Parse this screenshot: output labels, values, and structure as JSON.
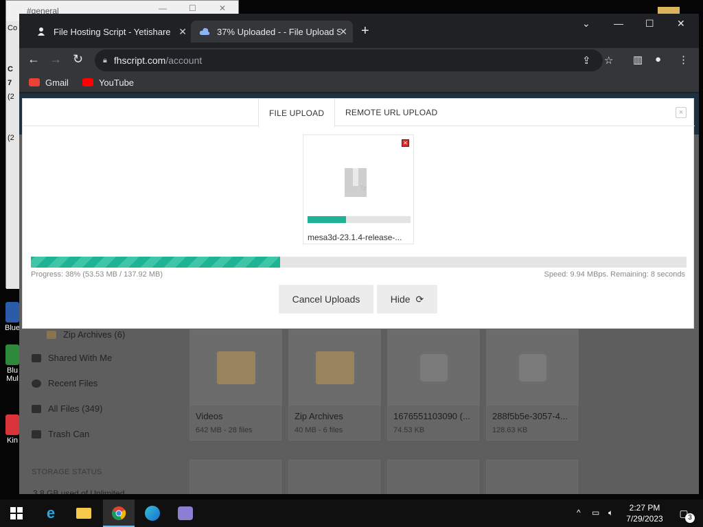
{
  "desktop": {
    "bg_window_title": "#general",
    "bg_window_menu": "Co",
    "bg_side_labels": [
      "C",
      "7",
      "(2",
      "(2"
    ],
    "icons": [
      {
        "label": "Blue"
      },
      {
        "label": "Blu Mul"
      },
      {
        "label": "Kin"
      }
    ]
  },
  "browser": {
    "tabs": [
      {
        "title": "File Hosting Script - Yetishare",
        "active": false
      },
      {
        "title": "37% Uploaded - - File Upload Sc",
        "active": true
      }
    ],
    "url_host": "fhscript.com",
    "url_path": "/account",
    "bookmarks": [
      {
        "label": "Gmail",
        "color": "#ea4335"
      },
      {
        "label": "YouTube",
        "color": "#ff0000"
      }
    ]
  },
  "sidebar": {
    "items": [
      {
        "label": "Zip Archives (6)"
      },
      {
        "label": "Shared With Me"
      },
      {
        "label": "Recent Files"
      },
      {
        "label": "All Files (349)"
      },
      {
        "label": "Trash Can"
      }
    ],
    "storage_title": "STORAGE STATUS",
    "storage_used": "3.8 GB used of Unlimited"
  },
  "files": [
    {
      "name": "Videos",
      "meta": "642 MB - 28 files",
      "kind": "folder"
    },
    {
      "name": "Zip Archives",
      "meta": "40 MB - 6 files",
      "kind": "folder"
    },
    {
      "name": "1676551103090 (...",
      "meta": "74.53 KB",
      "kind": "mp3"
    },
    {
      "name": "288f5b5e-3057-4...",
      "meta": "128.63 KB",
      "kind": "file"
    }
  ],
  "modal": {
    "tabs": [
      {
        "label": "FILE UPLOAD",
        "active": true
      },
      {
        "label": "REMOTE URL UPLOAD",
        "active": false
      }
    ],
    "close_symbol": "×",
    "file": {
      "name": "mesa3d-23.1.4-release-...",
      "tag": "7z",
      "progress": 0.37
    },
    "overall_progress": 0.38,
    "progress_text": "Progress: 38% (53.53 MB / 137.92 MB)",
    "speed_text": "Speed: 9.94 MBps. Remaining: 8 seconds",
    "cancel_label": "Cancel Uploads",
    "hide_label": "Hide"
  },
  "taskbar": {
    "time": "2:27 PM",
    "date": "7/29/2023",
    "notification_count": "3"
  },
  "colors": {
    "accent": "#1db394",
    "accent_light": "#3fc6a8",
    "chrome_dark": "#202124",
    "chrome_toolbar": "#35363a"
  }
}
